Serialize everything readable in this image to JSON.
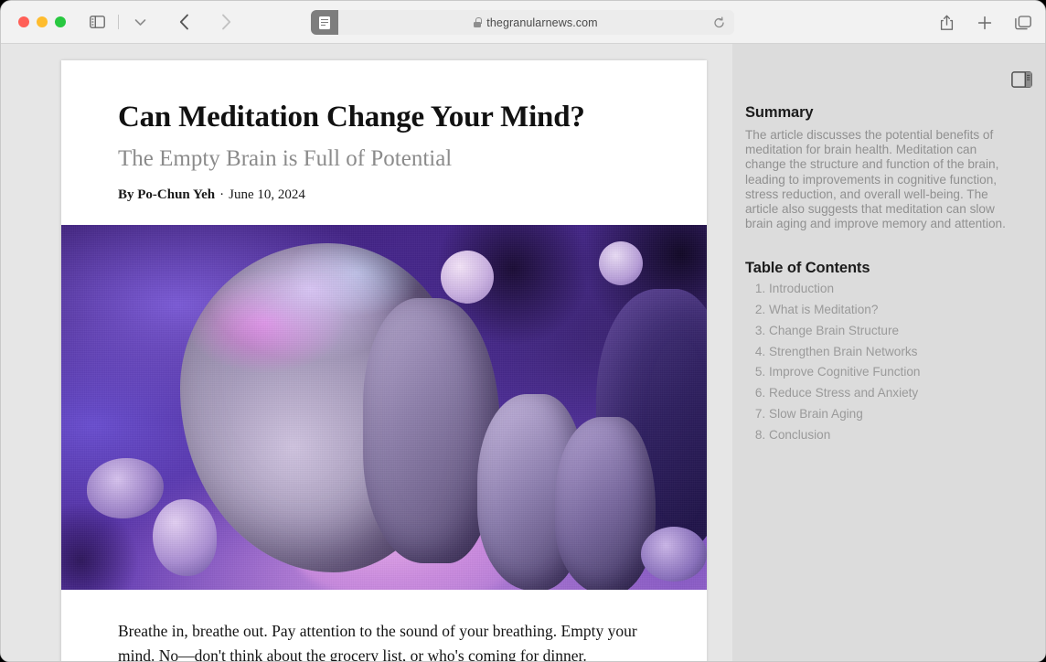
{
  "window": {
    "traffic_lights": [
      {
        "name": "close",
        "color": "#ff5f57"
      },
      {
        "name": "minimize",
        "color": "#febc2e"
      },
      {
        "name": "zoom",
        "color": "#28c840"
      }
    ]
  },
  "toolbar": {
    "sidebar_toggle": "sidebar-icon",
    "tab_overview_chevron": "chevron-down-icon",
    "back": "back-arrow-icon",
    "forward": "forward-arrow-icon",
    "reader_button": "reader-view-icon",
    "lock": "lock-icon",
    "url": "thegranularnews.com",
    "reload": "reload-icon",
    "share": "share-icon",
    "new_tab": "plus-icon",
    "tab_overview": "tab-overview-icon"
  },
  "article": {
    "title": "Can Meditation Change Your Mind?",
    "subtitle": "The Empty Brain is Full of Potential",
    "byline_author": "By Po-Chun Yeh",
    "byline_separator": "·",
    "byline_date": "June 10, 2024",
    "hero_alt": "Abstract purple rendering of receding human head profiles and spheres",
    "body_paragraph": "Breathe in, breathe out. Pay attention to the sound of your breathing. Empty your mind. No—don't think about the grocery list, or who's coming for dinner."
  },
  "sidebar": {
    "toggle_icon": "sidebar-panel-icon",
    "summary_heading": "Summary",
    "summary_text": "The article discusses the potential benefits of meditation for brain health. Meditation can change the structure and function of the brain, leading to improvements in cognitive function, stress reduction, and overall well-being. The article also suggests that meditation can slow brain aging and improve memory and attention.",
    "toc_heading": "Table of Contents",
    "toc": [
      "Introduction",
      "What is Meditation?",
      "Change Brain Structure",
      "Strengthen Brain Networks",
      "Improve Cognitive Function",
      "Reduce Stress and Anxiety",
      "Slow Brain Aging",
      "Conclusion"
    ]
  },
  "colors": {
    "window_bg": "#e6e6e6",
    "toolbar_bg": "#f2f2f2",
    "sidebar_bg": "#dcdcdc",
    "article_bg": "#ffffff",
    "muted_text": "#909090"
  }
}
